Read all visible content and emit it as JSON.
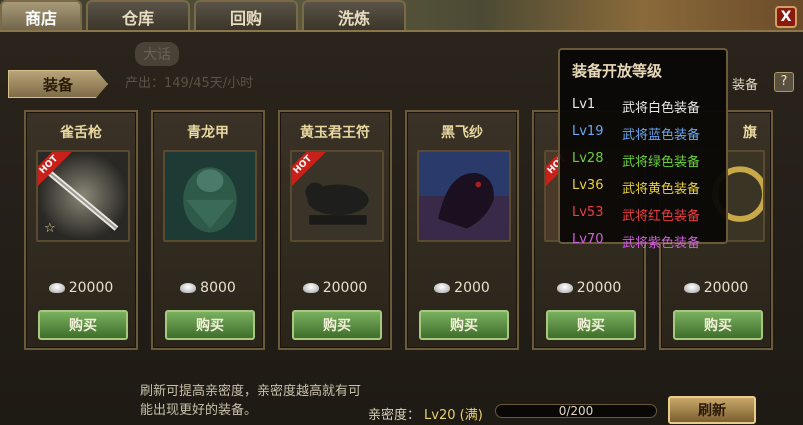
{
  "tabs": [
    "商店",
    "仓库",
    "回购",
    "洗炼"
  ],
  "category_tab": "装备",
  "faded_info": {
    "badge": "大话",
    "line": "产出：149/45天/小时"
  },
  "right_label": "装备",
  "help_label": "?",
  "close_label": "X",
  "items": [
    {
      "name": "雀舌枪",
      "price": "20000",
      "hot": true,
      "star": true,
      "buy": "购买"
    },
    {
      "name": "青龙甲",
      "price": "8000",
      "hot": false,
      "star": false,
      "buy": "购买"
    },
    {
      "name": "黄玉君王符",
      "price": "20000",
      "hot": true,
      "star": false,
      "buy": "购买"
    },
    {
      "name": "黑飞纱",
      "price": "2000",
      "hot": false,
      "star": false,
      "buy": "购买"
    },
    {
      "name": "",
      "price": "20000",
      "hot": true,
      "star": false,
      "buy": "购买"
    },
    {
      "name": "旗",
      "price": "20000",
      "hot": false,
      "star": false,
      "buy": "购买"
    }
  ],
  "hot_label": "HOT",
  "star_glyph": "☆",
  "tooltip": {
    "title": "装备开放等级",
    "rows": [
      {
        "lv": "Lv1",
        "text": "武将白色装备",
        "color": "#e8e8e8"
      },
      {
        "lv": "Lv19",
        "text": "武将蓝色装备",
        "color": "#6aa8f0"
      },
      {
        "lv": "Lv28",
        "text": "武将绿色装备",
        "color": "#6ad040"
      },
      {
        "lv": "Lv36",
        "text": "武将黄色装备",
        "color": "#e8d040"
      },
      {
        "lv": "Lv53",
        "text": "武将红色装备",
        "color": "#e84040"
      },
      {
        "lv": "Lv70",
        "text": "武将紫色装备",
        "color": "#d060e0"
      }
    ]
  },
  "footer": {
    "refresh_note": "刷新可提高亲密度，亲密度越高就有可能出现更好的装备。",
    "intimacy_label": "亲密度：",
    "intimacy_level": "Lv20 (满)",
    "progress_text": "0/200",
    "progress_value": 0,
    "refresh_button": "刷新"
  }
}
